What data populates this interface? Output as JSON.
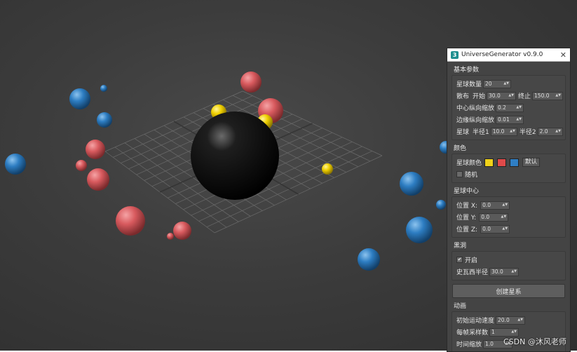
{
  "window": {
    "title": "UniverseGenerator v0.9.0",
    "app_icon_text": "3",
    "close_symbol": "✕"
  },
  "basic_params": {
    "label": "基本参数",
    "star_count_label": "星球数量",
    "star_count": "20",
    "distribution_label": "散布",
    "start_label": "开始",
    "start_value": "30.0",
    "end_label": "终止",
    "end_value": "150.0",
    "center_vscale_label": "中心纵向缩放",
    "center_vscale": "0.2",
    "edge_vscale_label": "边缘纵向缩放",
    "edge_vscale": "0.01",
    "planet_label": "星球",
    "radius1_label": "半径1",
    "radius1": "10.0",
    "radius2_label": "半径2",
    "radius2": "2.0"
  },
  "color": {
    "label": "颜色",
    "planet_color_label": "星球颜色",
    "swatches": [
      "#f1d21a",
      "#e04a4a",
      "#2f7fc4"
    ],
    "default_button": "默认",
    "random_label": "随机"
  },
  "center": {
    "label": "星球中心",
    "pos_x_label": "位置 X:",
    "pos_x": "0.0",
    "pos_y_label": "位置 Y:",
    "pos_y": "0.0",
    "pos_z_label": "位置 Z:",
    "pos_z": "0.0"
  },
  "black_hole": {
    "label": "黑洞",
    "enable_label": "开启",
    "enabled_mark": "✔",
    "schwarzschild_label": "史瓦西半径",
    "schwarzschild_radius": "30.0"
  },
  "create_button": "创建星系",
  "animation": {
    "label": "动画",
    "init_speed_label": "初始运动速度",
    "init_speed": "20.0",
    "samples_label": "每帧采样数",
    "samples": "1",
    "time_scale_label": "时间缩放",
    "time_scale": "1.0"
  },
  "watermark": "CSDN @沐风老师",
  "scene_colors": {
    "red": "#d85a5e",
    "blue": "#2d7dc2",
    "yellow": "#f0d000",
    "black_hole": "#0a0a0a",
    "grid": "#8a8a8a"
  }
}
